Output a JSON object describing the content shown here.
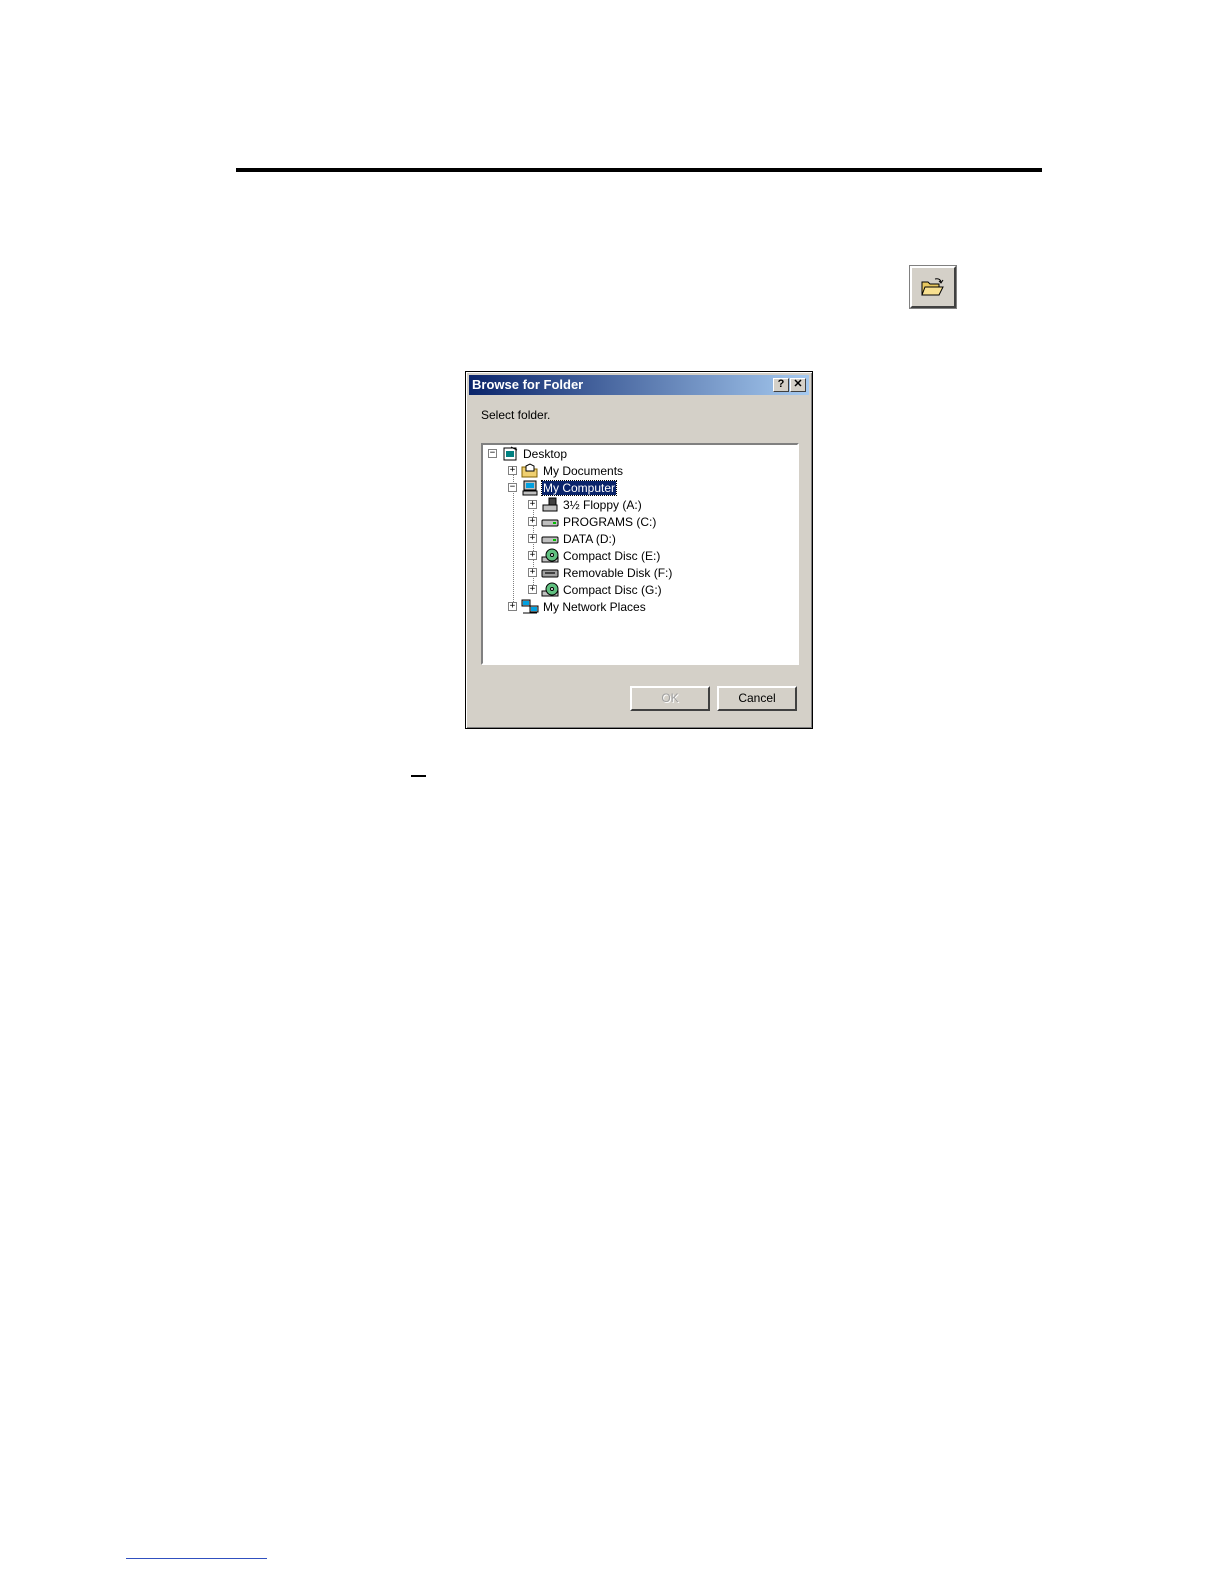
{
  "toolbar": {
    "open_folder_icon": "open-folder-icon"
  },
  "dialog": {
    "title": "Browse for Folder",
    "help_label": "?",
    "close_label": "✕",
    "prompt": "Select folder.",
    "tree": [
      {
        "label": "Desktop",
        "icon": "desktop-icon",
        "expander": "−"
      },
      {
        "label": "My Documents",
        "icon": "folder-icon",
        "expander": "+"
      },
      {
        "label": "My Computer",
        "icon": "computer-icon",
        "expander": "−",
        "selected": true
      },
      {
        "label": "3½ Floppy (A:)",
        "icon": "floppy-icon",
        "expander": "+"
      },
      {
        "label": "PROGRAMS (C:)",
        "icon": "drive-icon",
        "expander": "+"
      },
      {
        "label": "DATA (D:)",
        "icon": "drive-icon",
        "expander": "+"
      },
      {
        "label": "Compact Disc (E:)",
        "icon": "cd-icon",
        "expander": "+"
      },
      {
        "label": "Removable Disk (F:)",
        "icon": "removable-disk-icon",
        "expander": "+"
      },
      {
        "label": "Compact Disc (G:)",
        "icon": "cd-icon",
        "expander": "+"
      },
      {
        "label": "My Network Places",
        "icon": "network-icon",
        "expander": "+"
      }
    ],
    "ok_label": "OK",
    "cancel_label": "Cancel"
  }
}
